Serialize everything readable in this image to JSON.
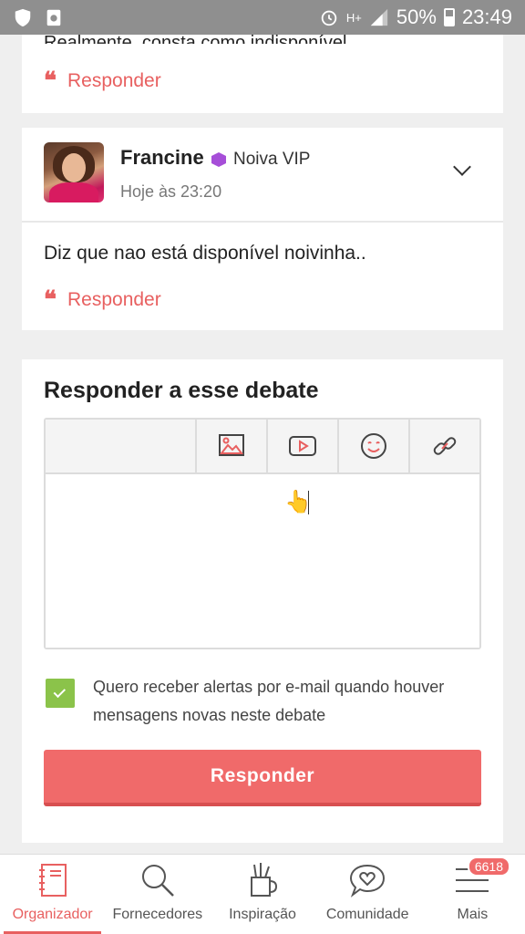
{
  "status_bar": {
    "network": "H+",
    "battery": "50%",
    "time": "23:49"
  },
  "previous_comment": {
    "cut_text": "Realmente, consta como indisponível",
    "reply_label": "Responder"
  },
  "comment": {
    "author": "Francine",
    "badge": "Noiva VIP",
    "time": "Hoje às 23:20",
    "text": "Diz que nao está disponível noivinha..",
    "reply_label": "Responder"
  },
  "reply_form": {
    "title": "Responder a esse debate",
    "toolbar_icons": [
      "image-icon",
      "video-icon",
      "emoji-icon",
      "link-icon"
    ],
    "editor_value": "",
    "email_alert_label": "Quero receber alertas por e-mail quando houver mensagens novas neste debate",
    "email_alert_checked": true,
    "submit_label": "Responder"
  },
  "bottom_nav": {
    "items": [
      {
        "label": "Organizador",
        "icon": "notebook-icon",
        "active": true
      },
      {
        "label": "Fornecedores",
        "icon": "search-icon",
        "active": false
      },
      {
        "label": "Inspiração",
        "icon": "pencil-cup-icon",
        "active": false
      },
      {
        "label": "Comunidade",
        "icon": "chat-heart-icon",
        "active": false
      },
      {
        "label": "Mais",
        "icon": "menu-icon",
        "active": false,
        "badge": "6618"
      }
    ]
  },
  "colors": {
    "accent": "#e86060",
    "button": "#f06a6a",
    "checkbox": "#8bc34a",
    "vip": "#a64ed8"
  }
}
